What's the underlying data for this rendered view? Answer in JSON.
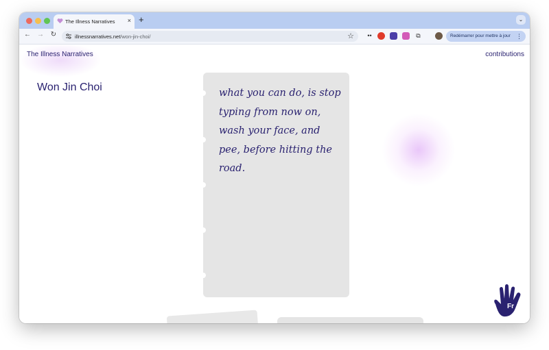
{
  "browser": {
    "tab_title": "The Illness Narratives",
    "tab_close": "×",
    "new_tab": "+",
    "tab_menu": "⌄",
    "url_host": "illnessnarratives.net",
    "url_path": "/won-jin-choi/",
    "back": "←",
    "forward": "→",
    "reload": "↻",
    "star": "☆",
    "update_label": "Redémarrer pour mettre à jour",
    "update_menu": "⋮"
  },
  "site": {
    "title": "The Illness Narratives",
    "nav_contributions": "contributions"
  },
  "content": {
    "author": "Won Jin Choi",
    "poem": "what you can do, is stop typing from now on, wash your face, and pee, before hitting the road."
  },
  "language_badge": "Fr",
  "colors": {
    "accent": "#2a2270",
    "card": "#e5e5e5",
    "glow": "#e2b4f7",
    "tabbar": "#b9cdf1"
  },
  "icons": [
    "heart-favicon",
    "tune-icon",
    "star-icon",
    "extension-icons",
    "hand-icon"
  ]
}
